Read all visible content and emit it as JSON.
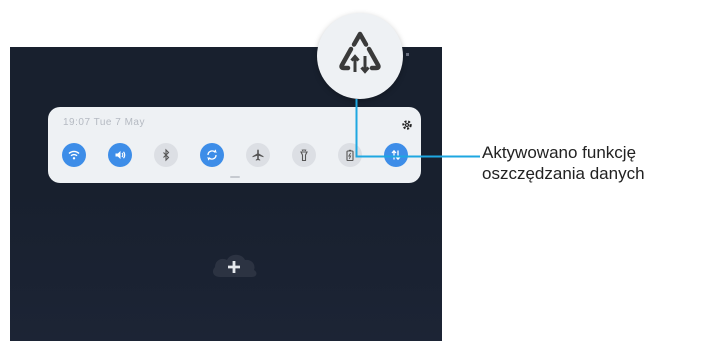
{
  "status_bar": {
    "datetime": "19:07 Tue 7 May"
  },
  "quick_panel": {
    "tiles": [
      {
        "name": "wifi-icon",
        "state": "on"
      },
      {
        "name": "sound-icon",
        "state": "on"
      },
      {
        "name": "bluetooth-icon",
        "state": "off"
      },
      {
        "name": "auto-rotate-icon",
        "state": "on"
      },
      {
        "name": "airplane-mode-icon",
        "state": "off"
      },
      {
        "name": "flashlight-icon",
        "state": "off"
      },
      {
        "name": "power-saving-icon",
        "state": "off"
      },
      {
        "name": "data-saver-icon",
        "state": "on"
      }
    ],
    "accent_color": "#3d8de8"
  },
  "magnified_icon": "data-saver-icon",
  "callout": {
    "line1": "Aktywowano funkcję",
    "line2": "oszczędzania danych"
  }
}
